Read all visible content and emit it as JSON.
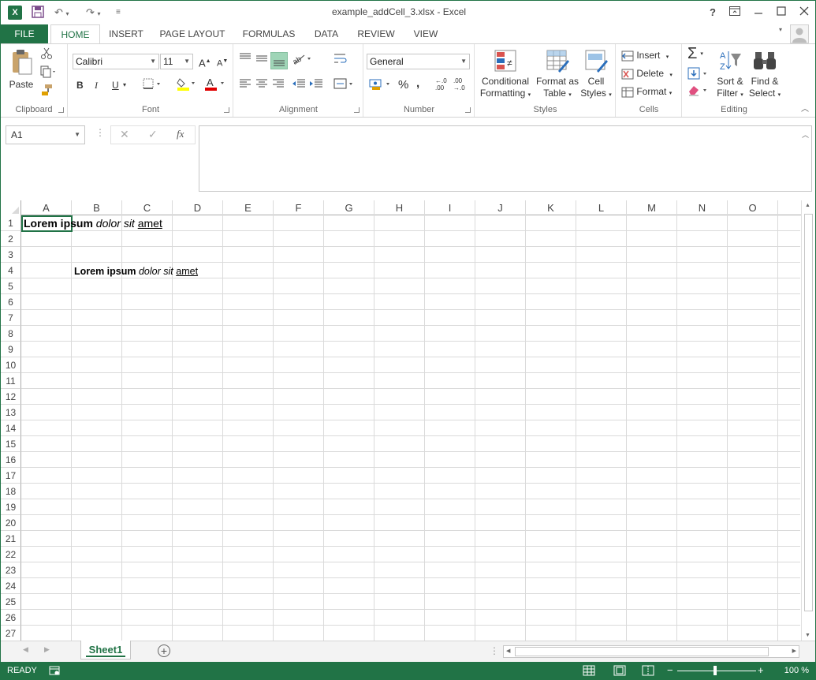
{
  "window": {
    "title": "example_addCell_3.xlsx - Excel",
    "help": "?",
    "logo": "X"
  },
  "tabs": {
    "file": "FILE",
    "items": [
      "HOME",
      "INSERT",
      "PAGE LAYOUT",
      "FORMULAS",
      "DATA",
      "REVIEW",
      "VIEW"
    ],
    "active": "HOME"
  },
  "ribbon": {
    "clipboard": {
      "label": "Clipboard",
      "paste": "Paste"
    },
    "font": {
      "label": "Font",
      "font_name": "Calibri",
      "font_size": "11",
      "bold": "B",
      "italic": "I",
      "underline": "U",
      "grow": "A",
      "shrink": "A",
      "color_letter": "A"
    },
    "alignment": {
      "label": "Alignment"
    },
    "number": {
      "label": "Number",
      "format": "General",
      "percent": "%",
      "comma": ",",
      "inc_dec": ".0",
      "dec_dec": ".00"
    },
    "styles": {
      "label": "Styles",
      "conditional_1": "Conditional",
      "conditional_2": "Formatting",
      "format_table_1": "Format as",
      "format_table_2": "Table",
      "cell_styles_1": "Cell",
      "cell_styles_2": "Styles"
    },
    "cells": {
      "label": "Cells",
      "insert": "Insert",
      "delete": "Delete",
      "format": "Format"
    },
    "editing": {
      "label": "Editing",
      "sort_1": "Sort &",
      "sort_2": "Filter",
      "find_1": "Find &",
      "find_2": "Select"
    }
  },
  "formula_bar": {
    "name_box": "A1",
    "fx": "fx",
    "formula": ""
  },
  "grid": {
    "columns": [
      "A",
      "B",
      "C",
      "D",
      "E",
      "F",
      "G",
      "H",
      "I",
      "J",
      "K",
      "L",
      "M",
      "N",
      "O"
    ],
    "rows": [
      "1",
      "2",
      "3",
      "4",
      "5",
      "6",
      "7",
      "8",
      "9",
      "10",
      "11",
      "12",
      "13",
      "14",
      "15",
      "16",
      "17",
      "18",
      "19",
      "20",
      "21",
      "22",
      "23",
      "24",
      "25",
      "26",
      "27"
    ],
    "cell_a1": {
      "bold": "Lorem ipsum",
      "italic": "dolor sit",
      "space": " ",
      "underline": "amet"
    },
    "cell_b4": {
      "bold": "Lorem ipsum",
      "italic": "dolor sit",
      "space": " ",
      "underline": "amet"
    }
  },
  "sheets": {
    "tabs": [
      "Sheet1"
    ]
  },
  "status": {
    "ready": "READY",
    "zoom": "100 %"
  },
  "colors": {
    "accent": "#217346"
  }
}
